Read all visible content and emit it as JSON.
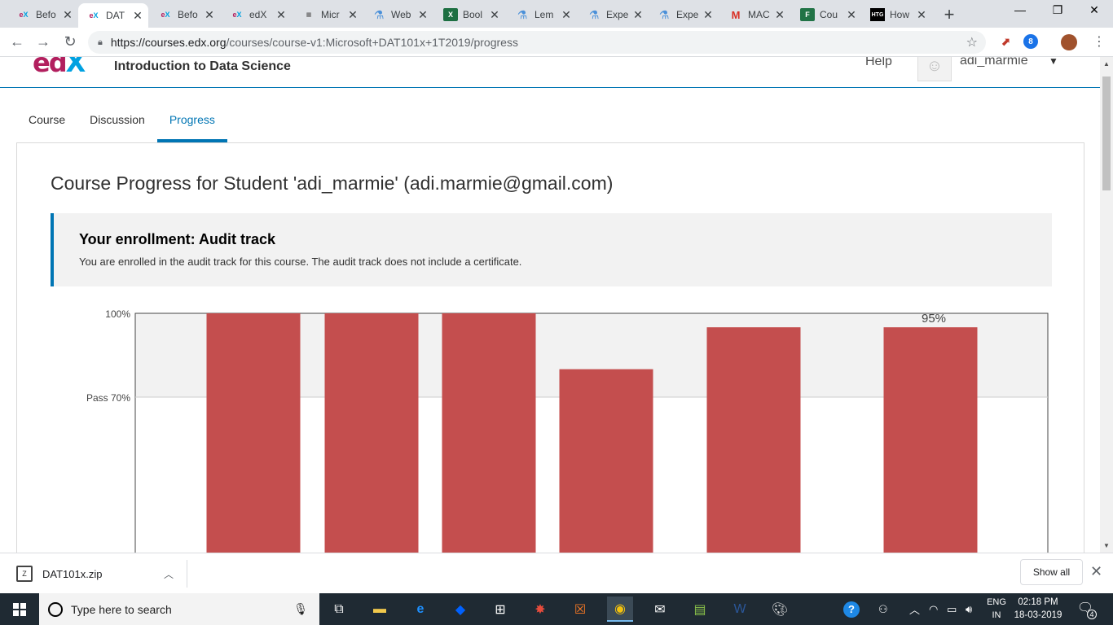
{
  "browser": {
    "tabs": [
      {
        "label": "Befo",
        "favicon": "edx-icon",
        "active": false
      },
      {
        "label": "DAT",
        "favicon": "edx-icon",
        "active": true
      },
      {
        "label": "Befo",
        "favicon": "edx-icon",
        "active": false
      },
      {
        "label": "edX",
        "favicon": "edx-icon",
        "active": false
      },
      {
        "label": "Micr",
        "favicon": "openedx-icon",
        "active": false
      },
      {
        "label": "Web",
        "favicon": "flask-icon",
        "active": false
      },
      {
        "label": "Bool",
        "favicon": "excel-icon",
        "active": false
      },
      {
        "label": "Lem",
        "favicon": "flask-icon",
        "active": false
      },
      {
        "label": "Expe",
        "favicon": "flask-icon",
        "active": false
      },
      {
        "label": "Expe",
        "favicon": "flask-icon",
        "active": false
      },
      {
        "label": "MAC",
        "favicon": "gmail-icon",
        "active": false
      },
      {
        "label": "Cou",
        "favicon": "forms-icon",
        "active": false
      },
      {
        "label": "How",
        "favicon": "htg-icon",
        "active": false
      }
    ],
    "tab_close": "✕",
    "new_tab": "+",
    "url_main": "https://courses.edx.org",
    "url_rest": "/courses/course-v1:Microsoft+DAT101x+1T2019/progress"
  },
  "header": {
    "logo": {
      "e": "e",
      "d": "d",
      "x": "X"
    },
    "course_name": "Introduction to Data Science",
    "help": "Help",
    "username": "adi_marmie"
  },
  "course_tabs": [
    {
      "label": "Course",
      "active": false
    },
    {
      "label": "Discussion",
      "active": false
    },
    {
      "label": "Progress",
      "active": true
    }
  ],
  "progress": {
    "title": "Course Progress for Student 'adi_marmie' (adi.marmie@gmail.com)",
    "enrollment_title": "Your enrollment: Audit track",
    "enrollment_text": "You are enrolled in the audit track for this course. The audit track does not include a certificate."
  },
  "chart_data": {
    "type": "bar",
    "y_tick_labels": [
      "100%",
      "Pass 70%"
    ],
    "y_ticks": [
      100,
      70
    ],
    "ylim": [
      0,
      100
    ],
    "values": [
      100,
      100,
      100,
      80,
      95,
      95
    ],
    "data_labels": [
      "",
      "",
      "",
      "",
      "",
      "95%"
    ],
    "bar_color": "#c44e4e",
    "grid": true
  },
  "downloads": {
    "file_name": "DAT101x.zip",
    "show_all": "Show all"
  },
  "taskbar": {
    "search_placeholder": "Type here to search",
    "lang_line1": "ENG",
    "lang_line2": "IN",
    "time": "02:18 PM",
    "date": "18-03-2019",
    "notifications": "4"
  }
}
